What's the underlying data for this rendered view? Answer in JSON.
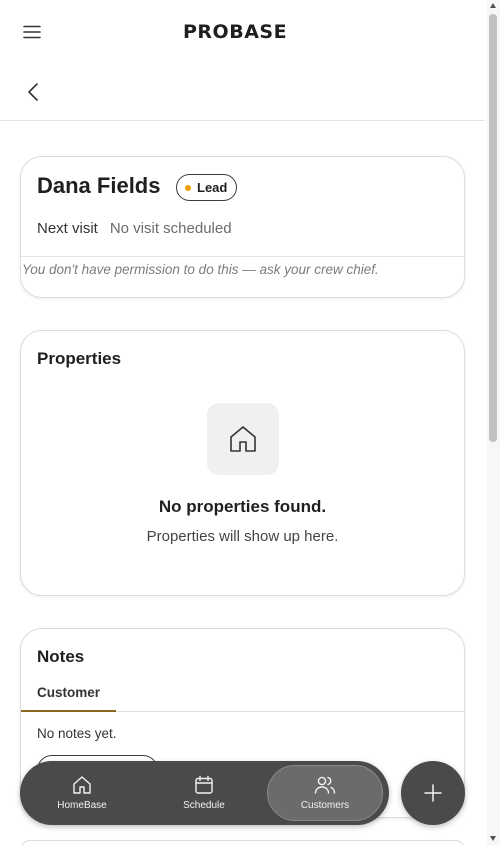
{
  "header": {
    "logo_text": "PROBASE",
    "menu_icon": "hamburger-menu-icon",
    "back_icon": "chevron-left-icon"
  },
  "customer": {
    "name": "Dana Fields",
    "status": "Lead",
    "status_color": "#f2a007",
    "next_visit_label": "Next visit",
    "next_visit_value": "No visit scheduled",
    "permission_note": "You don't have permission to do this — ask your crew chief."
  },
  "properties": {
    "title": "Properties",
    "empty_icon": "house-icon",
    "empty_title": "No properties found.",
    "empty_subtitle": "Properties will show up here."
  },
  "notes": {
    "title": "Notes",
    "tabs": [
      {
        "label": "Customer",
        "active": true
      }
    ],
    "empty_text": "No notes yet."
  },
  "bottom_nav": {
    "items": [
      {
        "label": "HomeBase",
        "icon": "home-icon",
        "active": false
      },
      {
        "label": "Schedule",
        "icon": "calendar-icon",
        "active": false
      },
      {
        "label": "Customers",
        "icon": "users-icon",
        "active": true
      }
    ],
    "fab_icon": "plus-icon"
  },
  "colors": {
    "nav_background": "#4a4a4a",
    "active_nav": "#6b6b6b",
    "tab_underline": "#8a6a1f"
  }
}
